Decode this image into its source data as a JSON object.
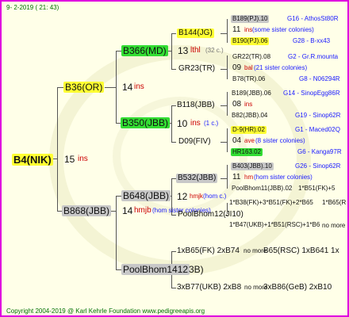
{
  "header": {
    "date": "9-  2-2019 ( 21: 43)"
  },
  "footer": {
    "copyright": "Copyright 2004-2019 @ Karl Kehrle Foundation    www.pedigreeapis.org"
  },
  "root": {
    "name": "B4(NIK)",
    "num": "15",
    "suffix": "ins"
  },
  "gen1": {
    "top": {
      "name": "B36(OR)",
      "num": "14",
      "suffix": "ins"
    },
    "bot": {
      "name": "B868(JBB)",
      "num": "14",
      "suffix": "hmjb",
      "note": "(hom sister colonies)"
    }
  },
  "gen2": {
    "a": {
      "name": "B366(MD)",
      "num": "13",
      "suffix": "lthl",
      "note": "(32 c.)"
    },
    "b": {
      "name": "B350(JBB)",
      "num": "10",
      "suffix": "ins",
      "note": "(1 c.)"
    },
    "c": {
      "name": "B648(JBB)",
      "num": "12",
      "suffix": "hmjk",
      "note": "(hom c.)"
    },
    "d": {
      "name": "PoolBhom1412",
      "tail": "3B)"
    }
  },
  "gen3": {
    "a1": {
      "name": "B144(JG)"
    },
    "a2": {
      "name": "GR23(TR)"
    },
    "b1": {
      "name": "B118(JBB)"
    },
    "b2": {
      "name": "D09(FIV)"
    },
    "c1": {
      "name": "B532(JBB)"
    },
    "c2": {
      "name": "PoolBhom12(JI10)"
    },
    "d1": {
      "name": "1xB65(FK) 2xB74",
      "over": "no more",
      "rest": "B65(RSC) 1xB641 1x"
    },
    "d2": {
      "name": "3xB77(UKB) 2xB8",
      "over": "no more",
      "rest": "3xB86(GeB) 2xB10"
    }
  },
  "gen4": [
    {
      "name": "B189(PJ).10",
      "code": "G16 - AthosSt80R"
    },
    {
      "num": "11",
      "suffix": "ins",
      "note": "(some sister colonies)"
    },
    {
      "name": "B190(PJ).06",
      "code": "G28 - B-xx43"
    },
    {
      "name": "GR22(TR).08",
      "code": "G2 - Gr.R.mounta"
    },
    {
      "num": "09",
      "suffix": "bal",
      "note": "(21 sister colonies)"
    },
    {
      "name": "B78(TR).06",
      "code": "G8 - N06294R"
    },
    {
      "name": "B189(JBB).06",
      "code": "G14 - SinopEgg86R"
    },
    {
      "num": "08",
      "suffix": "ins"
    },
    {
      "name": "B82(JBB).04",
      "code": "G19 - Sinop62R"
    },
    {
      "name": "D-9(HR).02",
      "code": "G1 - Maced02Q"
    },
    {
      "num": "04",
      "suffix": "ave",
      "note": "(8 sister colonies)"
    },
    {
      "name": "HR163.02",
      "code": "G6 - Kanga97R"
    },
    {
      "name": "B403(JBB).10",
      "code": "G26 - Sinop62R"
    },
    {
      "num": "11",
      "suffix": "hm",
      "note": "(hom sister colonies)"
    },
    {
      "name": "PoolBhom11(JBB).02",
      "code": "1*B51(FK)+5"
    },
    {
      "name": "1*B38(FK)+3*B51(FK)+2*B65",
      "code": "1*B65(R"
    },
    {
      "name": "1*B47(UKB)+1*B51(RSC)+1*B6",
      "code": "no more"
    }
  ]
}
